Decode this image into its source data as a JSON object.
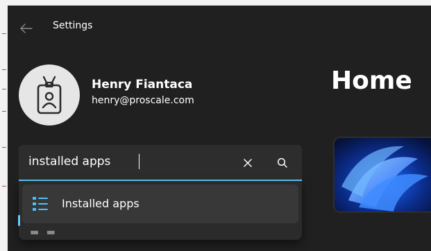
{
  "window": {
    "title": "Settings",
    "back_icon": "back-arrow-icon"
  },
  "user": {
    "name": "Henry Fiantaca",
    "email": "henry@proscale.com",
    "avatar_icon": "id-badge-icon"
  },
  "main": {
    "page_title": "Home"
  },
  "search": {
    "value": "installed apps",
    "clear_icon": "close-icon",
    "search_icon": "search-icon",
    "suggestions": [
      {
        "label": "Installed apps",
        "icon": "app-list-icon"
      }
    ]
  },
  "colors": {
    "accent": "#60cdff",
    "background": "#202020",
    "surface": "#2d2d2d"
  }
}
